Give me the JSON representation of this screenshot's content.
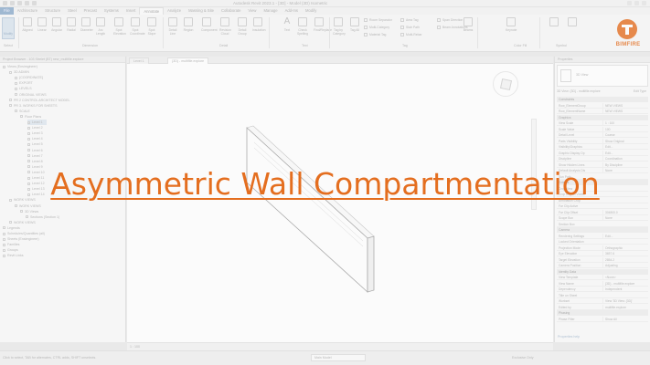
{
  "titlebar": {
    "title": "Autodesk Revit 2023.1 - [3D] - Model (3D) Isometric"
  },
  "tabs": [
    "File",
    "Architecture",
    "Structure",
    "Steel",
    "Precast",
    "Systems",
    "Insert",
    "Annotate",
    "Analyze",
    "Massing & Site",
    "Collaborate",
    "View",
    "Manage",
    "Add-Ins",
    "Modify"
  ],
  "ribbon": {
    "modify_label": "Modify",
    "buttons": [
      "Aligned",
      "Linear",
      "Angular",
      "Radial",
      "Diameter",
      "Arc Length",
      "Spot Elevation",
      "Spot Coordinate",
      "Spot Slope",
      "Detail Line",
      "Region",
      "Component",
      "Revision Cloud",
      "Detail Group",
      "Insulation",
      "Text",
      "Check Spelling",
      "Find/Replace",
      "Tag by Category",
      "Tag All",
      "Beams",
      "Keynote"
    ],
    "small": [
      "Room Separator",
      "Multi-Category",
      "Material Tag",
      "Area Tag",
      "Stair Path",
      "Multi-Rebar",
      "Span Direction",
      "Beam Annotations"
    ],
    "panels": [
      "Select",
      "Dimension",
      "Detail",
      "Text",
      "Tag",
      "Color Fill",
      "Symbol"
    ]
  },
  "logo": {
    "word": "BIMFIRE"
  },
  "browser": {
    "header": "Project Browser - 103 Strelet (BT) new_multifile.explore",
    "rows": [
      "Views (Ensimgineer)",
      "3D ADMIN",
      "{COORDINATE}",
      "EXPORT",
      "LEVELS",
      "ORIGINAL VIEWS",
      "PR 2 CONTROL ARCHITECT MODEL",
      "PR 3. WORKS FOR SHEETS",
      "SCALE",
      "Floor Plans",
      "Level 1",
      "Level 2",
      "Level 3",
      "Level 4",
      "Level 5",
      "Level 6",
      "Level 7",
      "Level 8",
      "Level 9",
      "Level 10",
      "Level 11",
      "Level 12",
      "Level 13",
      "Level 14",
      "WORK VIEWS",
      "WORK VIEWS",
      "3D Views",
      "Sections (Section 1)",
      "WORK VIEWS",
      "Legends",
      "Schedules/Quantities (all)",
      "Sheets (Ensimgineer)",
      "Families",
      "Groups",
      "Revit Links"
    ]
  },
  "viewtabs": [
    "Level 1",
    "{3D} - multifile.explore"
  ],
  "properties": {
    "header": "Properties",
    "type_name": "3D View",
    "selector": "3D View: {3D} - multifile.explore",
    "edit_type": "Edit Type",
    "groups": [
      "Constraints",
      "Graphics",
      "Extents",
      "Camera",
      "Identity Data",
      "Phasing"
    ],
    "rows": [
      [
        "Row_ElementGroup",
        "NEW VIEWS"
      ],
      [
        "Row_ElementName",
        "NEW VIEWS"
      ],
      [
        "View Scale",
        "1 : 100"
      ],
      [
        "Scale Value",
        "100"
      ],
      [
        "Detail Level",
        "Coarse"
      ],
      [
        "Parts Visibility",
        "Show Original"
      ],
      [
        "Visibility/Graphics",
        "Edit..."
      ],
      [
        "Graphic Display Op",
        "Edit..."
      ],
      [
        "Discipline",
        "Coordination"
      ],
      [
        "Show Hidden Lines",
        "By Discipline"
      ],
      [
        "Default Analysis Dis",
        "None"
      ],
      [
        "Sun Path",
        ""
      ],
      [
        "Crop View",
        ""
      ],
      [
        "Crop Region Visible",
        ""
      ],
      [
        "Annotation Crop",
        ""
      ],
      [
        "Far Clip Active",
        ""
      ],
      [
        "Far Clip Offset",
        "304800.0"
      ],
      [
        "Scope Box",
        "None"
      ],
      [
        "Section Box",
        ""
      ],
      [
        "Rendering Settings",
        "Edit..."
      ],
      [
        "Locked Orientation",
        ""
      ],
      [
        "Projection Mode",
        "Orthographic"
      ],
      [
        "Eye Elevation",
        "3657.6"
      ],
      [
        "Target Elevation",
        "2854.2"
      ],
      [
        "Camera Position",
        "Adjusting"
      ],
      [
        "View Template",
        "<None>"
      ],
      [
        "View Name",
        "{3D} - multifile.explore"
      ],
      [
        "Dependency",
        "Independent"
      ],
      [
        "Title on Sheet",
        ""
      ],
      [
        "Workset",
        "View '3D View: {3D}'"
      ],
      [
        "Edited by",
        "multifile.explore"
      ],
      [
        "Phase Filter",
        "Show All"
      ]
    ],
    "help": "Properties help"
  },
  "viewctl": {
    "scale": "1 : 100"
  },
  "statusbar": {
    "message": "Click to select, TAB for alternates, CTRL adds, SHIFT unselects.",
    "model": "Main Model",
    "edit": "Exclusive Only"
  },
  "overlay": {
    "headline": "Asymmetric Wall Compartmentation"
  },
  "colors": {
    "accent": "#e46e1f",
    "file_tab": "#8aaac9"
  }
}
